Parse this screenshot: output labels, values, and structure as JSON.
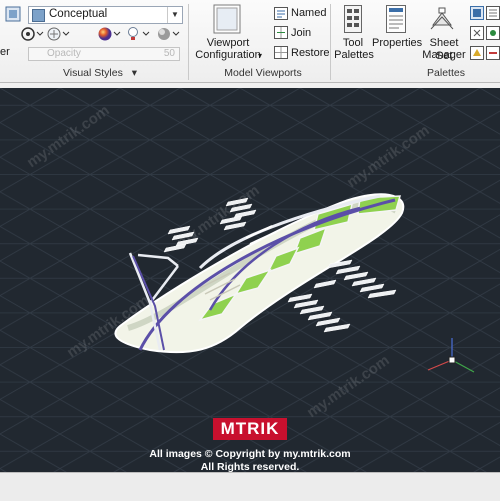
{
  "ribbon": {
    "visual_styles": {
      "edge_label": "er",
      "style_value": "Conceptual",
      "opacity_label": "Opacity",
      "opacity_value": "50",
      "panel_label": "Visual Styles",
      "panel_arrow": "▾"
    },
    "model_viewports": {
      "viewport_config_line1": "Viewport",
      "viewport_config_line2": "Configuration",
      "named_label": "Named",
      "join_label": "Join",
      "restore_label": "Restore",
      "panel_label": "Model Viewports"
    },
    "palettes": {
      "tool_palettes_line1": "Tool",
      "tool_palettes_line2": "Palettes",
      "properties_label": "Properties",
      "sheet_set_line1": "Sheet Set",
      "sheet_set_line2": "Manager",
      "panel_label": "Palettes"
    }
  },
  "overlay": {
    "logo_text": "MTRIK",
    "copyright_line1": "All images © Copyright by my.mtrik.com",
    "copyright_line2": "All Rights reserved.",
    "watermark_text": "my.mtrik.com"
  },
  "colors": {
    "viewport_bg": "#212830",
    "grid": "#3a4450",
    "roof_green": "#8fd14f",
    "structure_purple": "#5b4fa8",
    "structure_white": "#e9ecf2",
    "logo_red": "#c8102e"
  },
  "icons": [
    "visual-style-icon",
    "circle-icon",
    "material-ball-icon",
    "light-icon",
    "shadow-icon",
    "viewport-config-icon",
    "named-views-icon",
    "join-icon",
    "restore-icon",
    "tool-palettes-icon",
    "properties-icon",
    "sheet-set-icon",
    "ucs-icon"
  ]
}
